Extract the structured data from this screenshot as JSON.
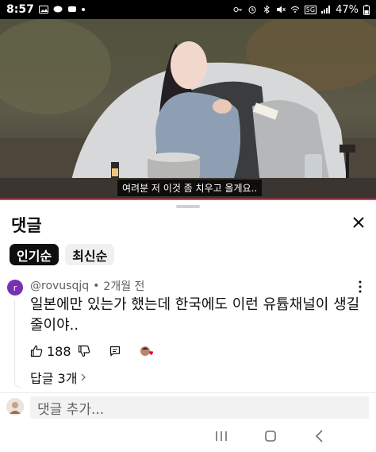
{
  "status_bar": {
    "time": "8:57",
    "network": "5G",
    "battery": "47%"
  },
  "video": {
    "subtitle": "여려분 저 이것 좀 치우고 올게요..",
    "progress_color": "#ff2d55"
  },
  "comments_panel": {
    "title": "댓글",
    "sort_chips": [
      {
        "label": "인기순",
        "active": true
      },
      {
        "label": "최신순",
        "active": false
      }
    ],
    "comment": {
      "avatar_letter": "r",
      "author": "@rovusqjq",
      "separator": "•",
      "time": "2개월 전",
      "text": "일본에만 있는가 했는데 한국에도 이런 유튭채널이 생길줄이야..",
      "likes": "188",
      "replies_label": "답글 3개"
    },
    "add_comment_placeholder": "댓글 추가..."
  },
  "icons": {
    "close": "close-icon",
    "more": "more-vert-icon",
    "like": "thumb-up-icon",
    "dislike": "thumb-down-icon",
    "reply": "comment-icon",
    "creator_heart": "creator-heart-icon"
  }
}
